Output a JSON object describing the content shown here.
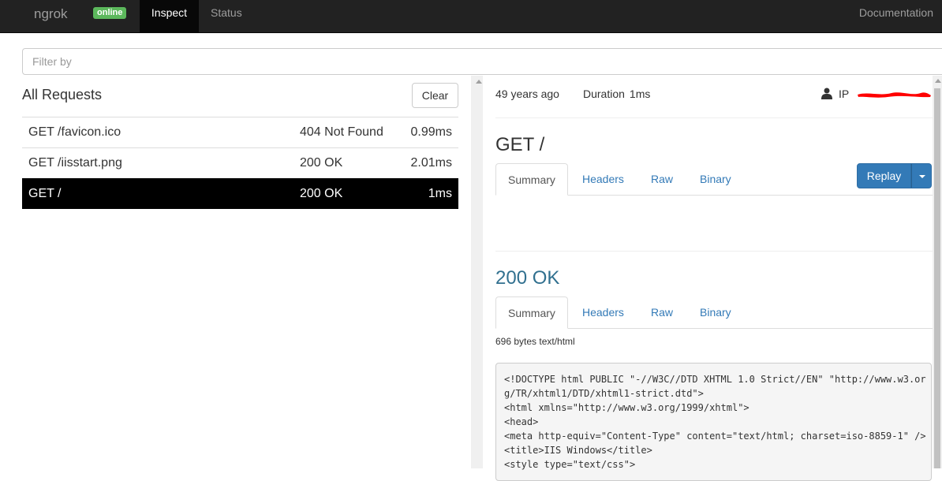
{
  "navbar": {
    "brand": "ngrok",
    "badge": "online",
    "tab_inspect": "Inspect",
    "tab_status": "Status",
    "docs": "Documentation"
  },
  "filter": {
    "placeholder": "Filter by",
    "value": ""
  },
  "requests": {
    "title": "All Requests",
    "clear_label": "Clear",
    "rows": [
      {
        "path": "GET /favicon.ico",
        "status": "404 Not Found",
        "duration": "0.99ms",
        "active": false
      },
      {
        "path": "GET /iisstart.png",
        "status": "200 OK",
        "duration": "2.01ms",
        "active": false
      },
      {
        "path": "GET /",
        "status": "200 OK",
        "duration": "1ms",
        "active": true
      }
    ]
  },
  "detail": {
    "time_ago": "49 years ago",
    "duration_label": "Duration",
    "duration_value": "1ms",
    "ip_label": "IP",
    "request_heading": "GET /",
    "replay_label": "Replay",
    "request_tabs": [
      "Summary",
      "Headers",
      "Raw",
      "Binary"
    ],
    "response_heading": "200 OK",
    "response_tabs": [
      "Summary",
      "Headers",
      "Raw",
      "Binary"
    ],
    "response_size": "696 bytes text/html",
    "code_lines": [
      "<!DOCTYPE html PUBLIC \"-//W3C//DTD XHTML 1.0 Strict//EN\" \"http://www.w3.or",
      "g/TR/xhtml1/DTD/xhtml1-strict.dtd\">",
      "<html xmlns=\"http://www.w3.org/1999/xhtml\">",
      "<head>",
      "<meta http-equiv=\"Content-Type\" content=\"text/html; charset=iso-8859-1\" />",
      "<title>IIS Windows</title>",
      "<style type=\"text/css\">"
    ]
  },
  "colors": {
    "navbar_bg": "#222222",
    "badge_green": "#5cb85c",
    "link_blue": "#337ab7",
    "response_heading": "#31708f",
    "active_row": "#000000",
    "redaction": "#ff0000"
  },
  "icons": {
    "user": "user-icon"
  }
}
